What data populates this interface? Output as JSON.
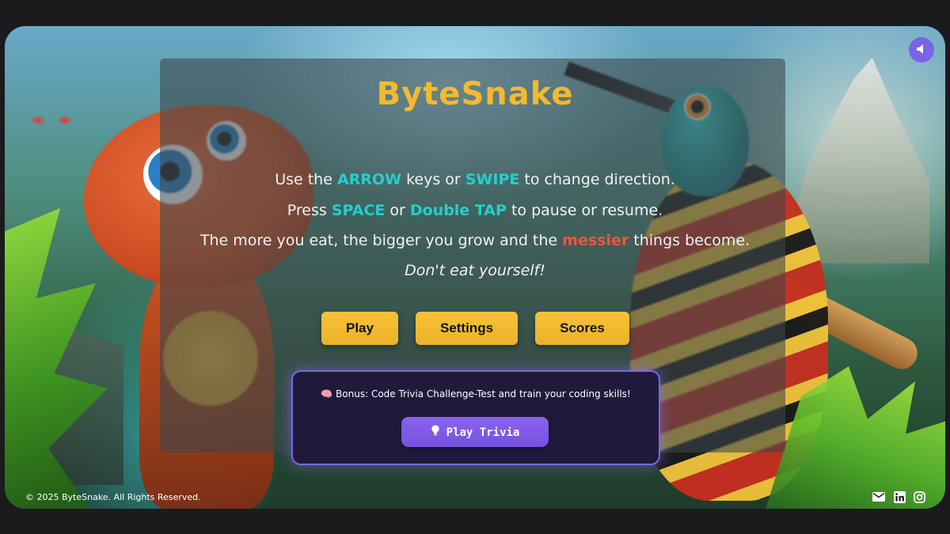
{
  "game": {
    "title": "ByteSnake"
  },
  "instructions": {
    "line1": {
      "pre": "Use the ",
      "key1": "ARROW",
      "mid": " keys or ",
      "key2": "SWIPE",
      "post": " to change direction."
    },
    "line2": {
      "pre": "Press ",
      "key1": "SPACE",
      "mid": " or ",
      "key2": "Double TAP",
      "post": " to pause or resume."
    },
    "line3": {
      "pre": "The more you eat, the bigger you grow and the ",
      "key": "messier",
      "post": " things become."
    },
    "line4": "Don't eat yourself!"
  },
  "menu": {
    "play": "Play",
    "settings": "Settings",
    "scores": "Scores"
  },
  "bonus": {
    "icon": "brain-icon",
    "emoji": "🧠",
    "text": "Bonus: Code Trivia Challenge-Test and train your coding skills!",
    "button_label": "Play Trivia",
    "button_icon": "lightbulb-icon"
  },
  "footer": {
    "copyright": "© 2025 ByteSnake. All Rights Reserved.",
    "social_icons": [
      "mail-icon",
      "linkedin-icon",
      "instagram-icon"
    ]
  },
  "sound_toggle_icon": "speaker-icon",
  "colors": {
    "title": "#f5b92d",
    "highlight": "#23cfd0",
    "highlight_red": "#f0553a",
    "button": "#f7c238",
    "trivia_button": "#7b58e6",
    "sound_button": "#7b62e8"
  }
}
